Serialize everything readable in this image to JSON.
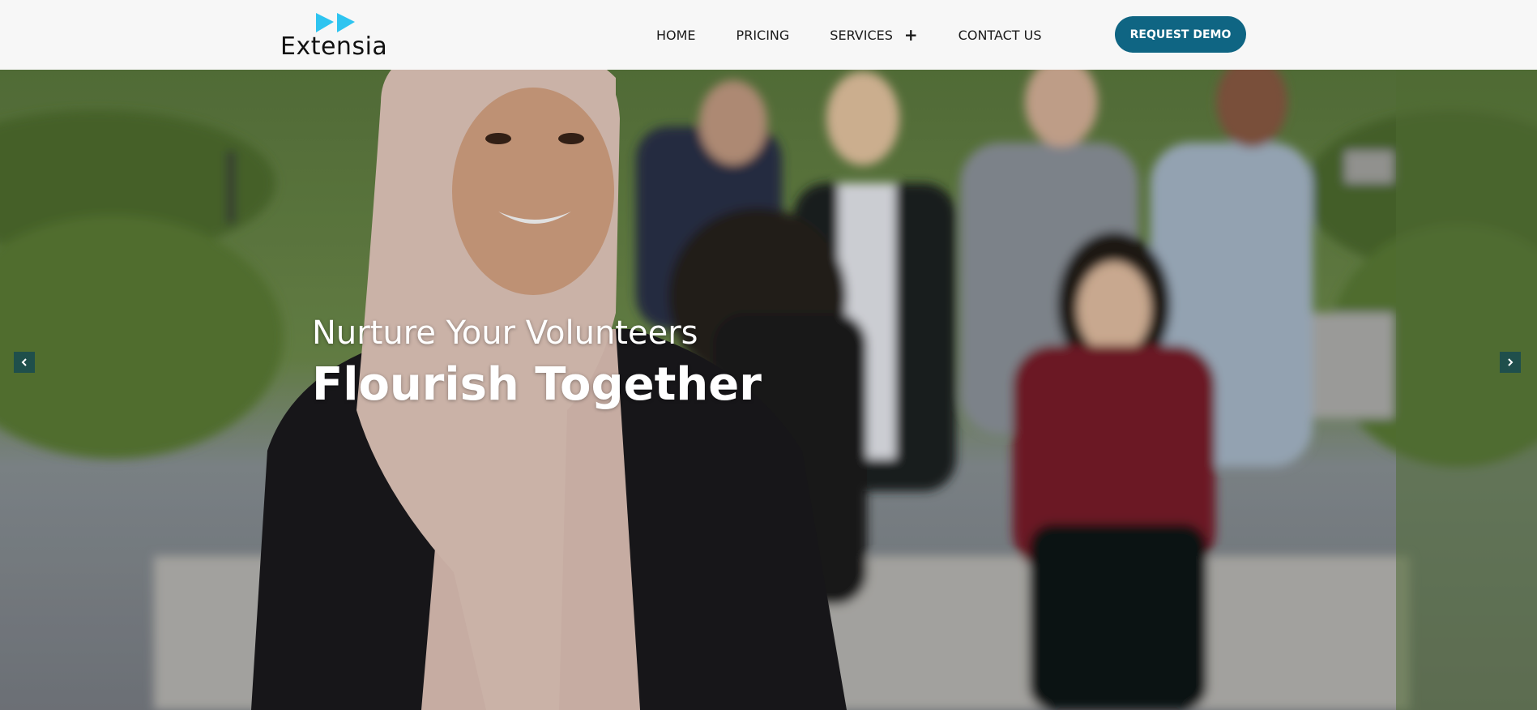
{
  "brand": {
    "name": "Extensia",
    "mark_color": "#2ec4f0"
  },
  "nav": {
    "items": [
      {
        "label": "HOME"
      },
      {
        "label": "PRICING"
      },
      {
        "label": "SERVICES",
        "icon": "plus-icon"
      },
      {
        "label": "CONTACT US"
      }
    ],
    "cta_label": "REQUEST DEMO",
    "cta_color": "#0f6583"
  },
  "hero": {
    "subtitle": "Nurture Your Volunteers",
    "title": "Flourish Together",
    "prev_icon": "chevron-left-icon",
    "next_icon": "chevron-right-icon"
  }
}
